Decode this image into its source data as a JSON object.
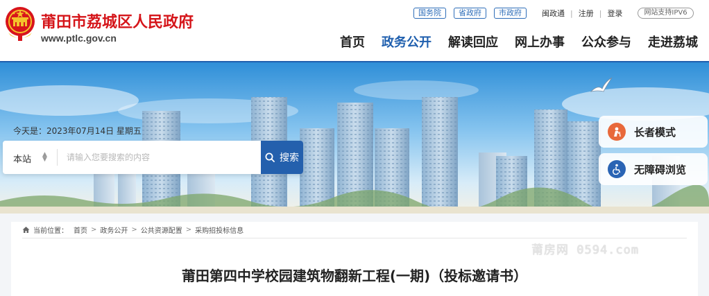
{
  "header": {
    "title": "莆田市荔城区人民政府",
    "domain": "www.ptlc.gov.cn",
    "top_links": {
      "gov_pills": [
        "国务院",
        "省政府",
        "市政府"
      ],
      "mintong": "闽政通",
      "register": "注册",
      "login": "登录",
      "ipv6": "网站支持IPV6"
    },
    "nav": [
      "首页",
      "政务公开",
      "解读回应",
      "网上办事",
      "公众参与",
      "走进荔城"
    ],
    "active_nav": "政务公开"
  },
  "banner": {
    "date": "今天是：2023年07月14日 星期五",
    "search": {
      "scope": "本站",
      "placeholder": "请输入您要搜索的内容",
      "button_label": "搜索"
    },
    "modes": {
      "elder": "长者模式",
      "accessible": "无障碍浏览"
    }
  },
  "breadcrumb": {
    "label": "当前位置：",
    "items": [
      "首页",
      "政务公开",
      "公共资源配置",
      "采购招投标信息"
    ]
  },
  "watermark": "莆房网 0594.com",
  "article": {
    "title": "莆田第四中学校园建筑物翻新工程(一期)（投标邀请书）"
  },
  "colors": {
    "brand_red": "#d5151a",
    "brand_blue": "#1f5fae",
    "elder_icon": "#e8693b",
    "accessible_icon": "#2a64b4"
  }
}
